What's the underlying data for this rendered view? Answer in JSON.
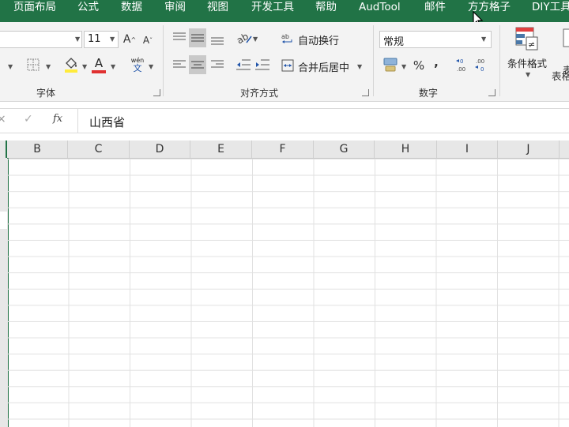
{
  "menu": [
    "页面布局",
    "公式",
    "数据",
    "审阅",
    "视图",
    "开发工具",
    "帮助",
    "AudTool",
    "邮件",
    "方方格子",
    "DIY工具"
  ],
  "font": {
    "size": "11",
    "increase_label": "A",
    "decrease_label": "A",
    "wen_top": "wén",
    "wen_bottom": "文",
    "color_letter": "A",
    "group_label": "字体",
    "fill_color": "#ffeb3b",
    "font_color": "#e03131"
  },
  "alignment": {
    "wrap_label": "自动换行",
    "merge_label": "合并后居中",
    "group_label": "对齐方式"
  },
  "number": {
    "format_value": "常规",
    "percent": "%",
    "comma": ",",
    "group_label": "数字"
  },
  "styles": {
    "cond_format_label": "条件格式",
    "table_label": "表格"
  },
  "formula_bar": {
    "cancel_glyph": "×",
    "enter_glyph": "✓",
    "fx_label": "fx",
    "content": "山西省"
  },
  "columns": [
    "B",
    "C",
    "D",
    "E",
    "F",
    "G",
    "H",
    "I",
    "J"
  ],
  "colors": {
    "accent": "#217346"
  }
}
